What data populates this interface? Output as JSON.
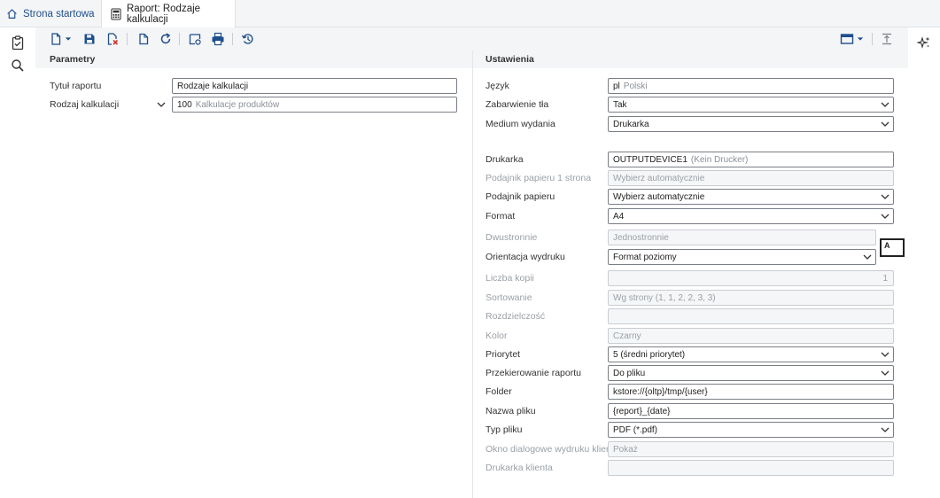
{
  "tabs": {
    "home_label": "Strona startowa",
    "report_label": "Raport: Rodzaje kalkulacji"
  },
  "icons": {
    "rail": [
      "clipboard-check-icon",
      "search-icon"
    ],
    "toolbar": [
      "new-document-icon",
      "dropdown-arrow-icon",
      "save-icon",
      "delete-document-icon",
      "duplicate-icon",
      "refresh-icon",
      "preview-icon",
      "print-icon",
      "history-icon"
    ],
    "toolbar_right": [
      "window-layout-icon",
      "dropdown-arrow-icon",
      "collapse-top-icon"
    ],
    "ai": "sparkle-icon"
  },
  "left_panel": {
    "title": "Parametry",
    "rows": [
      {
        "label": "Tytuł raportu",
        "value": "Rodzaje kalkulacji"
      },
      {
        "label": "Rodzaj kalkulacji",
        "code": "100",
        "desc": "Kalkulacje produktów"
      }
    ]
  },
  "right_panel": {
    "title": "Ustawienia",
    "language": {
      "label": "Język",
      "code": "pl",
      "desc": "Polski"
    },
    "background": {
      "label": "Zabarwienie tła",
      "value": "Tak"
    },
    "medium": {
      "label": "Medium wydania",
      "value": "Drukarka"
    },
    "printer": {
      "label": "Drukarka",
      "code": "OUTPUTDEVICE1",
      "desc": "(Kein Drucker)"
    },
    "tray1": {
      "label": "Podajnik papieru 1 strona",
      "value": "Wybierz automatycznie"
    },
    "tray": {
      "label": "Podajnik papieru",
      "value": "Wybierz automatycznie"
    },
    "format": {
      "label": "Format",
      "value": "A4"
    },
    "duplex": {
      "label": "Dwustronnie",
      "value": "Jednostronnie"
    },
    "orientation": {
      "label": "Orientacja wydruku",
      "value": "Format poziomy",
      "preview_letter": "A"
    },
    "copies": {
      "label": "Liczba kopii",
      "value": "1"
    },
    "sorting": {
      "label": "Sortowanie",
      "value": "Wg strony (1, 1, 2, 2, 3, 3)"
    },
    "resolution": {
      "label": "Rozdzielczość",
      "value": ""
    },
    "color": {
      "label": "Kolor",
      "value": "Czarny"
    },
    "priority": {
      "label": "Priorytet",
      "value": "5 (średni priorytet)"
    },
    "redirect": {
      "label": "Przekierowanie raportu",
      "value": "Do pliku"
    },
    "folder": {
      "label": "Folder",
      "value": "kstore://{oltp}/tmp/{user}"
    },
    "filename": {
      "label": "Nazwa pliku",
      "value": "{report}_{date}"
    },
    "filetype": {
      "label": "Typ pliku",
      "value": "PDF (*.pdf)"
    },
    "client_dialog": {
      "label": "Okno dialogowe wydruku klien...",
      "value": "Pokaż"
    },
    "client_printer": {
      "label": "Drukarka klienta",
      "value": ""
    }
  }
}
